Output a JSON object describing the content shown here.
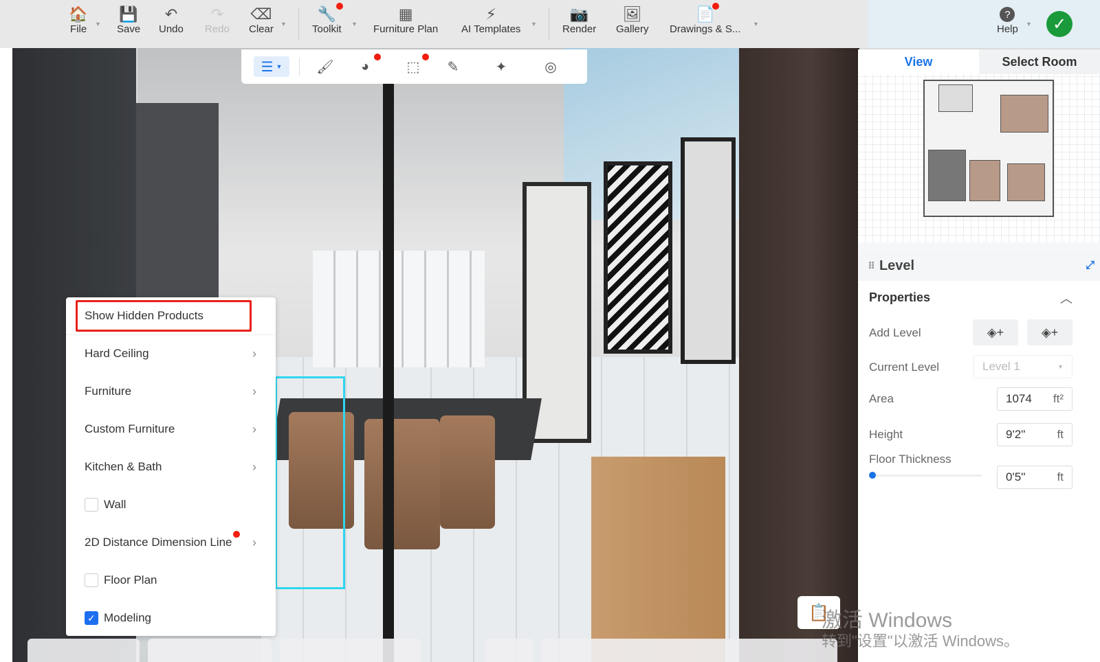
{
  "toolbar": {
    "items": [
      {
        "label": "File",
        "icon": "file-home-icon"
      },
      {
        "label": "Save",
        "icon": "save-icon"
      },
      {
        "label": "Undo",
        "icon": "undo-icon"
      },
      {
        "label": "Redo",
        "icon": "redo-icon"
      },
      {
        "label": "Clear",
        "icon": "eraser-icon"
      },
      {
        "label": "Toolkit",
        "icon": "wrench-icon"
      },
      {
        "label": "Furniture Plan",
        "icon": "furniture-plan-icon"
      },
      {
        "label": "AI Templates",
        "icon": "lightning-icon"
      },
      {
        "label": "Render",
        "icon": "camera-icon"
      },
      {
        "label": "Gallery",
        "icon": "image-icon"
      },
      {
        "label": "Drawings & S...",
        "icon": "drawings-icon"
      },
      {
        "label": "Help",
        "icon": "help-icon"
      }
    ]
  },
  "context_menu": {
    "items": [
      {
        "label": "Show Hidden Products",
        "type": "action"
      },
      {
        "label": "Hard Ceiling",
        "type": "submenu"
      },
      {
        "label": "Furniture",
        "type": "submenu"
      },
      {
        "label": "Custom Furniture",
        "type": "submenu"
      },
      {
        "label": "Kitchen & Bath",
        "type": "submenu"
      },
      {
        "label": "Wall",
        "type": "checkbox",
        "checked": false
      },
      {
        "label": "2D Distance Dimension Line",
        "type": "submenu"
      },
      {
        "label": "Floor Plan",
        "type": "checkbox",
        "checked": false
      },
      {
        "label": "Modeling",
        "type": "checkbox",
        "checked": true
      }
    ]
  },
  "right_panel": {
    "tabs": [
      "View",
      "Select Room"
    ],
    "level_title": "Level",
    "section": "Properties",
    "add_level_label": "Add Level",
    "current_level_label": "Current Level",
    "current_level_value": "Level 1",
    "area_label": "Area",
    "area_value": "1074",
    "area_unit": "ft²",
    "height_label": "Height",
    "height_value": "9'2''",
    "height_unit": "ft",
    "floor_thickness_label": "Floor Thickness",
    "floor_thickness_value": "0'5''",
    "floor_thickness_unit": "ft",
    "floor_thickness_slider_fraction": 0.0
  },
  "watermark": {
    "line1": "激活 Windows",
    "line2": "转到\"设置\"以激活 Windows。"
  },
  "colors": {
    "accent": "#1a73e8",
    "highlight": "#e8201a",
    "confirm": "#1a9a3a",
    "badge": "#f21d0d"
  }
}
